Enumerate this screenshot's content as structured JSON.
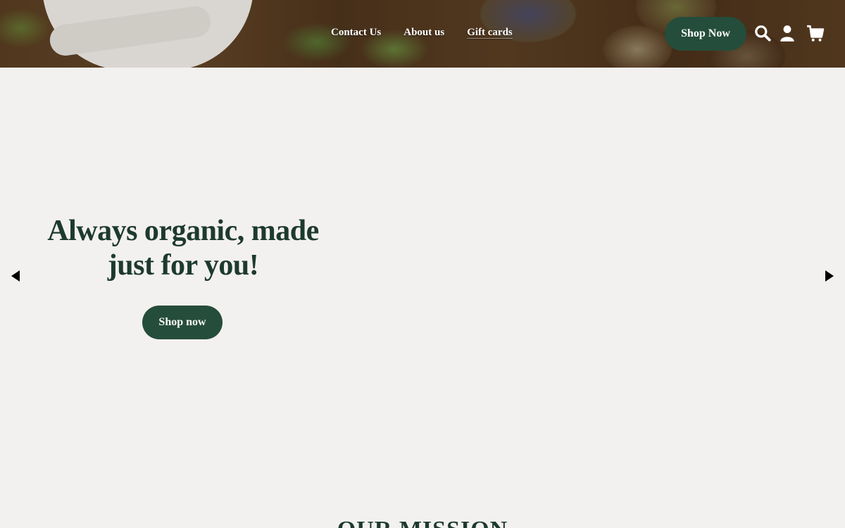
{
  "header": {
    "nav": [
      {
        "label": "Contact Us"
      },
      {
        "label": "About us"
      },
      {
        "label": "Gift cards"
      }
    ],
    "cta_label": "Shop Now",
    "icons": [
      "search-icon",
      "account-icon",
      "cart-icon"
    ]
  },
  "hero": {
    "title": "Always organic, made just for you!",
    "button_label": "Shop now"
  },
  "carousel": {
    "prev_icon": "chevron-left-icon",
    "next_icon": "chevron-right-icon"
  },
  "mission": {
    "heading": "OUR MISSION"
  },
  "colors": {
    "brand_green": "#254d3b",
    "heading_green": "#1d3a2e",
    "background": "#f3f1ef"
  }
}
